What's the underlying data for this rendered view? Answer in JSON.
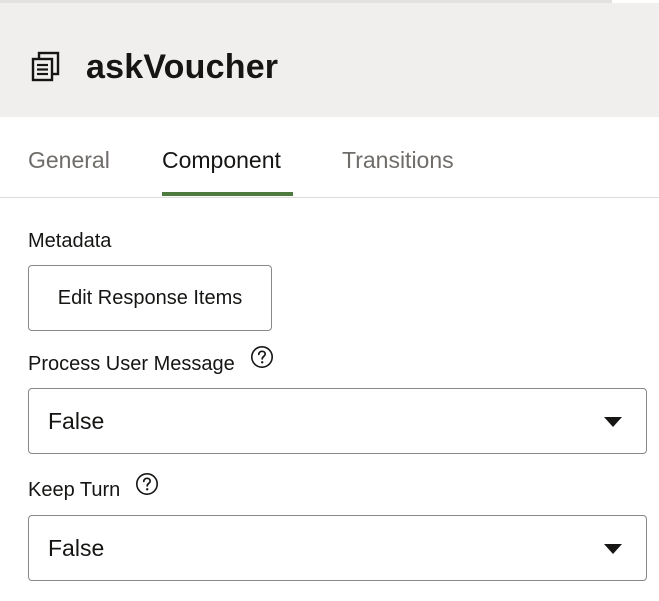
{
  "header": {
    "title": "askVoucher",
    "icon": "document-stack-icon"
  },
  "tabs": [
    {
      "label": "General",
      "active": false
    },
    {
      "label": "Component",
      "active": true
    },
    {
      "label": "Transitions",
      "active": false
    }
  ],
  "metadata": {
    "label": "Metadata",
    "button_label": "Edit Response Items"
  },
  "process_user_message": {
    "label": "Process User Message",
    "value": "False"
  },
  "keep_turn": {
    "label": "Keep Turn",
    "value": "False"
  },
  "colors": {
    "accent": "#4d7a3f",
    "header_bg": "#f1efed"
  }
}
